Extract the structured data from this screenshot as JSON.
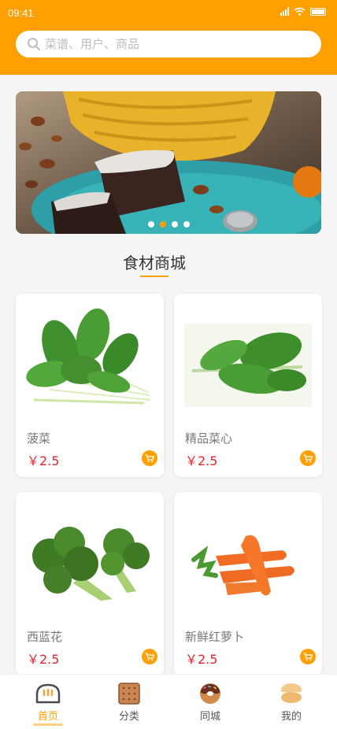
{
  "status_bar": {
    "time": "09:41"
  },
  "search": {
    "placeholder": "菜谱、用户、商品",
    "icon": "search-icon"
  },
  "banner": {
    "dot_count": 4,
    "active_dot": 1
  },
  "section": {
    "title": "食材商城"
  },
  "products": [
    {
      "name": "菠菜",
      "price": "￥2.5",
      "image": "spinach"
    },
    {
      "name": "精品菜心",
      "price": "￥2.5",
      "image": "choy-sum"
    },
    {
      "name": "西蓝花",
      "price": "￥2.5",
      "image": "broccoli"
    },
    {
      "name": "新鲜红萝卜",
      "price": "￥2.5",
      "image": "carrot"
    }
  ],
  "tabbar": {
    "tabs": [
      {
        "label": "首页",
        "icon": "bread-icon",
        "active": true
      },
      {
        "label": "分类",
        "icon": "biscuit-icon",
        "active": false
      },
      {
        "label": "同城",
        "icon": "donut-icon",
        "active": false
      },
      {
        "label": "我的",
        "icon": "macaron-icon",
        "active": false
      }
    ]
  },
  "colors": {
    "accent": "#ff9f00",
    "price": "#e8242e",
    "background": "#f5f5f5"
  }
}
